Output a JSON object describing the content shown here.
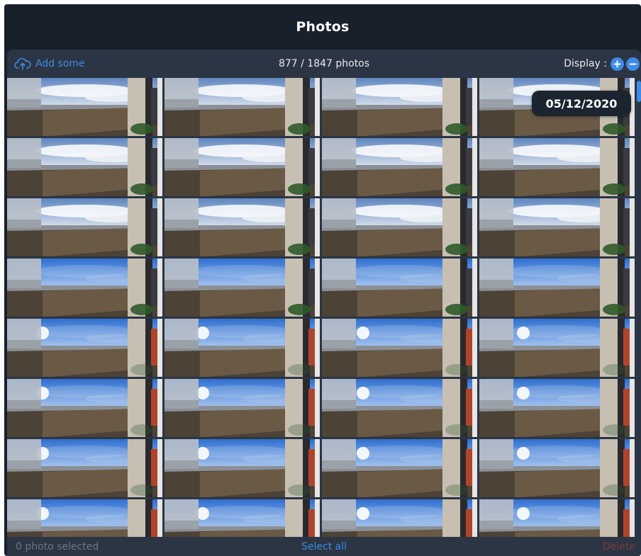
{
  "header": {
    "title": "Photos"
  },
  "toolbar": {
    "add_label": "Add some",
    "add_icon": "cloud-upload-icon",
    "count_label": "877 / 1847 photos",
    "display_label": "Display :",
    "zoom_in_icon": "plus-circle-icon",
    "zoom_out_icon": "minus-circle-icon"
  },
  "grid": {
    "date_badge": "05/12/2020",
    "columns": 4,
    "thumbnail_count": 32
  },
  "footer": {
    "selected_label": "0 photo selected",
    "select_all_label": "Select all",
    "delete_label": "Delete"
  },
  "colors": {
    "background": "#18202c",
    "panel": "#2c3543",
    "accent": "#3d8be8",
    "danger": "#7a3b40",
    "muted_text": "#6c7684"
  }
}
